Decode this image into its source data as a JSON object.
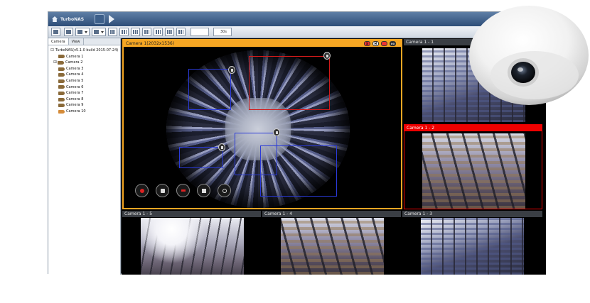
{
  "window": {
    "title": "TurboNAS"
  },
  "toolbar": {
    "select_value": "",
    "zoom_value": "30s"
  },
  "sidebar": {
    "tabs": [
      "Camera",
      "View"
    ],
    "root": "TurboNAS(v5.1.0 build 2015-07-24)",
    "cameras": [
      "Camera 1",
      "Camera 2",
      "Camera 3",
      "Camera 4",
      "Camera 5",
      "Camera 6",
      "Camera 7",
      "Camera 8",
      "Camera 9",
      "Camera 10"
    ]
  },
  "panes": {
    "main": {
      "title": "Camera 1(2032x1536)",
      "buttons": [
        "S",
        "M",
        "",
        "oo"
      ]
    },
    "p1": {
      "title": "Camera 1 - 1"
    },
    "p2": {
      "title": "Camera 1 - 2"
    },
    "p3": {
      "title": "Camera 1 - 5"
    },
    "p4": {
      "title": "Camera 1 - 4"
    },
    "p5": {
      "title": "Camera 1 - 3"
    }
  },
  "colors": {
    "selected_border": "#f5a623",
    "alarm_border": "#ee0000",
    "roi_box": "#2a3ad8",
    "roi_box_alt": "#d21a1a"
  },
  "icons": [
    "home-icon",
    "layout-icon",
    "play-icon",
    "record-icon",
    "snapshot-icon",
    "stop-icon",
    "document-icon",
    "ptz-icon",
    "trash-icon",
    "fisheye-camera-icon"
  ]
}
